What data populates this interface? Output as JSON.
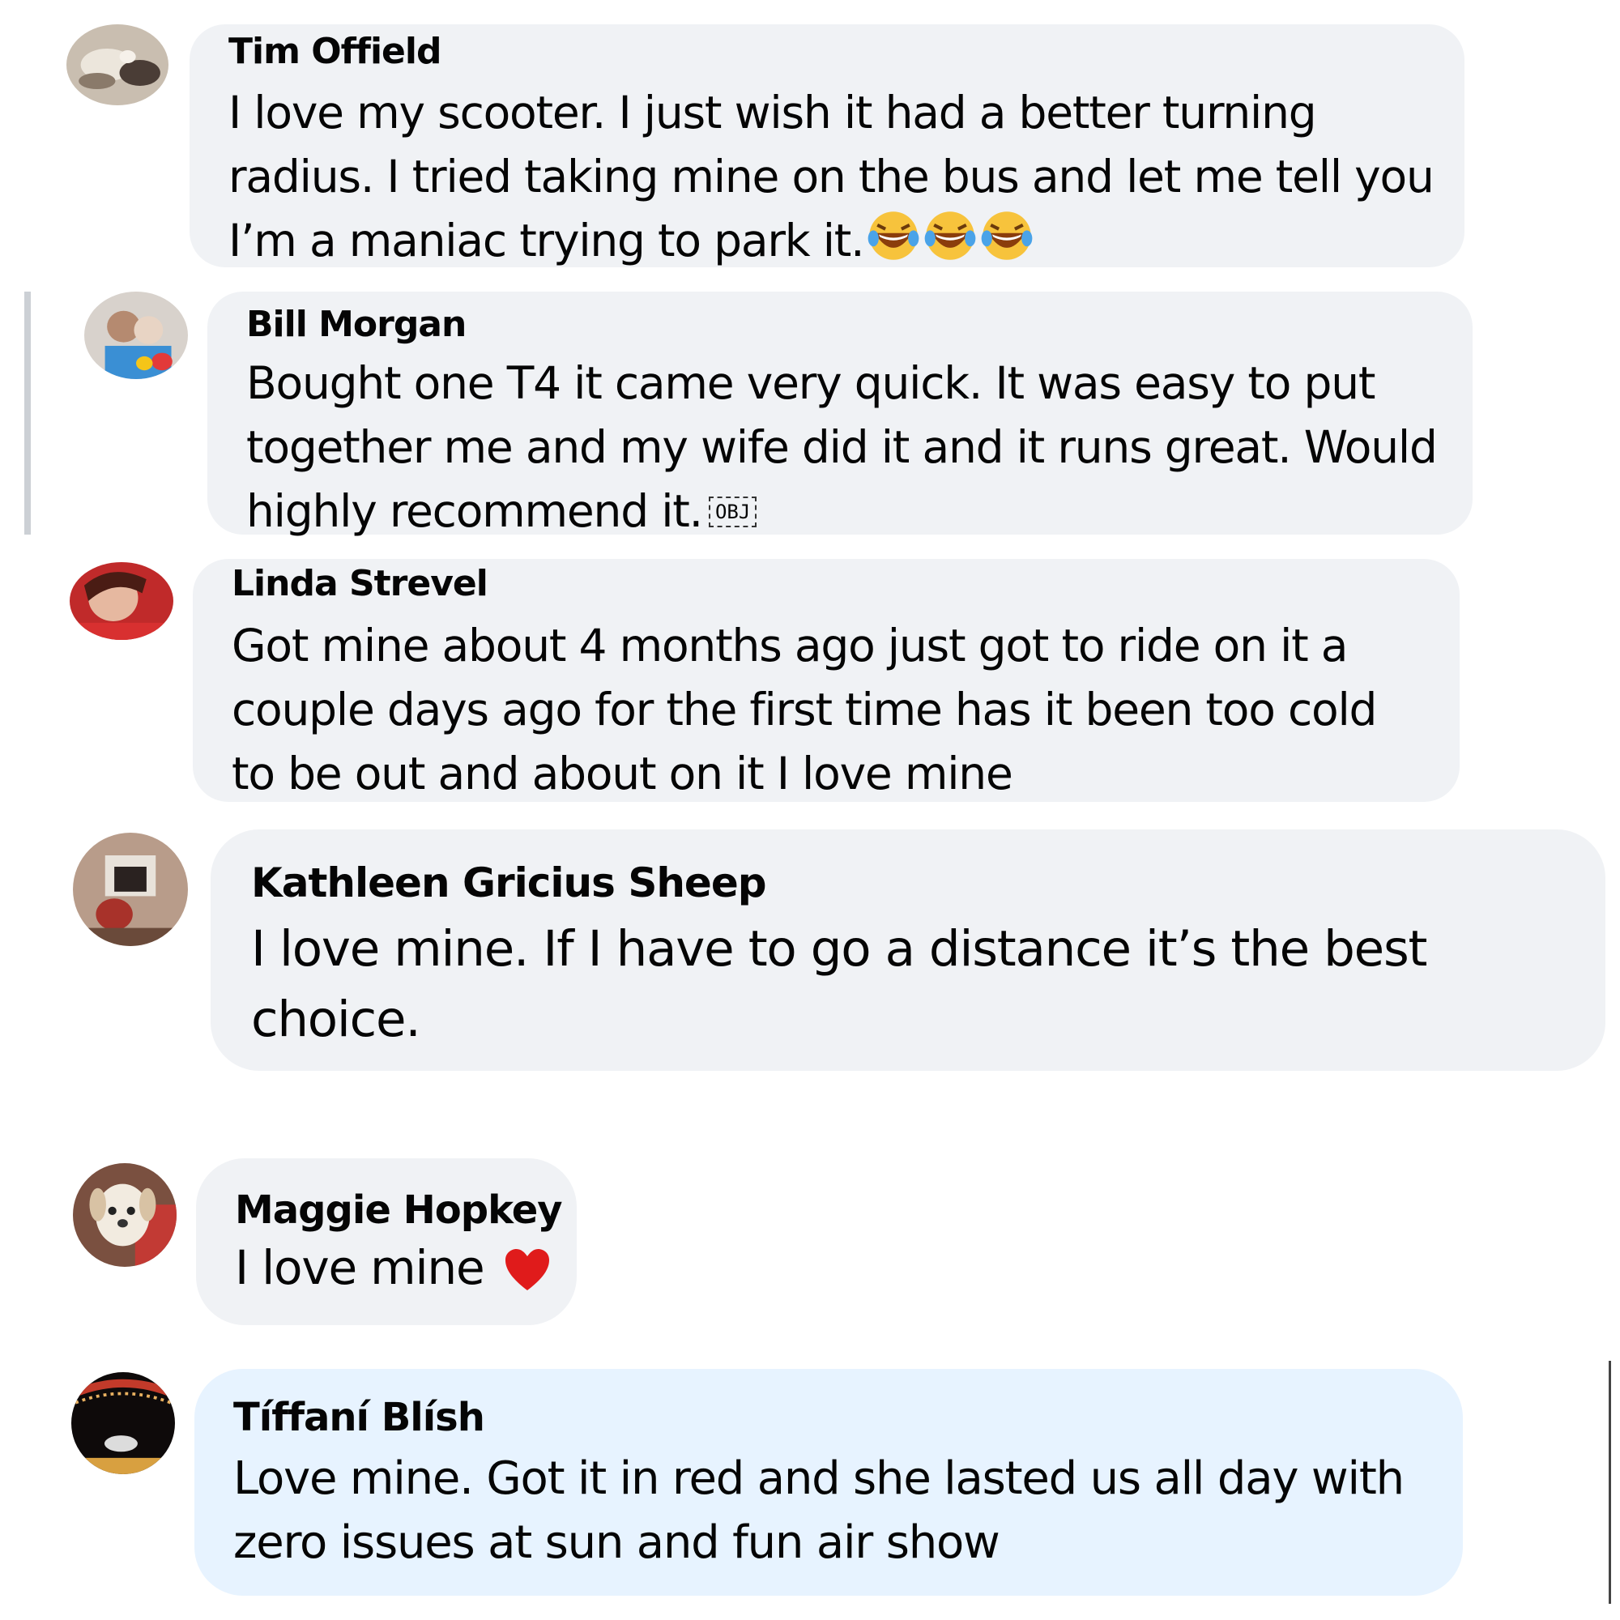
{
  "comments": [
    {
      "author": "Tim Offield",
      "text": "I love my scooter. I just wish it had a better turning\nradius. I tried taking mine on the bus and let me tell you\nI’m a maniac trying to park it.",
      "emojis": [
        "laughing-tears-emoji",
        "laughing-tears-emoji",
        "laughing-tears-emoji"
      ]
    },
    {
      "author": "Bill Morgan",
      "text": "Bought one T4 it came very quick. It was easy to put\ntogether me and my wife did it and it runs great. Would\nhighly recommend it.",
      "trailing_glyph": "OBJ"
    },
    {
      "author": "Linda Strevel",
      "text": "Got mine about 4 months ago just got to ride on it a\ncouple days ago for the first time has it been too cold\nto be out and about on it I love mine"
    },
    {
      "author": "Kathleen Gricius Sheep",
      "text": "I love mine. If I have to go a distance it’s the best\nchoice."
    },
    {
      "author": "Maggie Hopkey",
      "text": "I love mine",
      "emojis": [
        "red-heart-emoji"
      ]
    },
    {
      "author": "Tíffaní Blísh",
      "text": "Love mine. Got it in red and she lasted us all day with\nzero issues at sun and fun air show",
      "highlighted": true
    }
  ],
  "colors": {
    "bubble": "#f0f2f5",
    "bubble_highlight": "#e7f3ff",
    "text": "#050505",
    "thread_line": "#ccd0d5"
  }
}
